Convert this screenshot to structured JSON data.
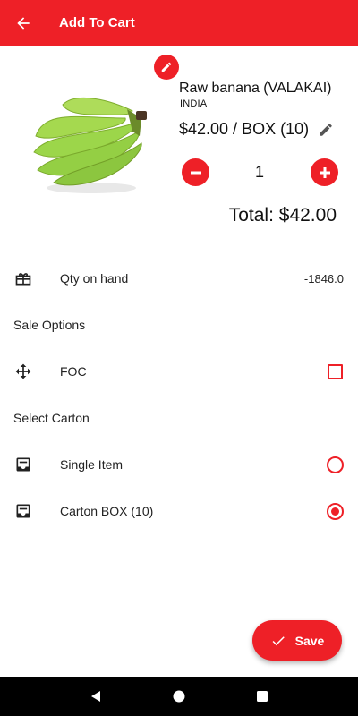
{
  "colors": {
    "accent": "#ee2027",
    "nav_bar": "#000000",
    "banana_green": "#9cd64a"
  },
  "appbar": {
    "title": "Add To Cart",
    "back_icon": "arrow-left-icon"
  },
  "product": {
    "name": "Raw banana (VALAKAI)",
    "origin": "INDIA",
    "price": "$42.00 / BOX (10)",
    "quantity": "1",
    "total": "Total: $42.00"
  },
  "stock": {
    "label": "Qty on hand",
    "value": "-1846.0"
  },
  "sale_options": {
    "heading": "Sale Options",
    "foc": {
      "label": "FOC",
      "checked": false
    }
  },
  "carton": {
    "heading": "Select Carton",
    "options": [
      {
        "label": "Single Item",
        "selected": false
      },
      {
        "label": "Carton BOX (10)",
        "selected": true
      }
    ]
  },
  "save_button": {
    "label": "Save"
  },
  "system_nav": [
    "back-triangle-icon",
    "home-circle-icon",
    "recents-square-icon"
  ]
}
